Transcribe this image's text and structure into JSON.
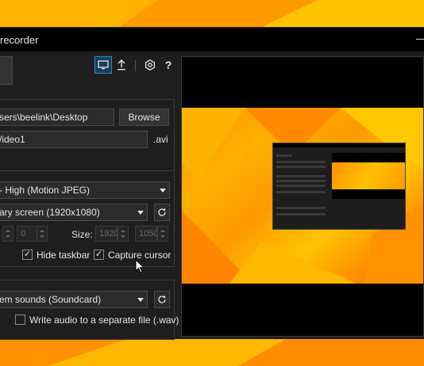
{
  "window": {
    "title": "recorder"
  },
  "toolbar": {
    "icons": [
      "monitor-icon",
      "upload-icon",
      "gear-icon",
      "question-icon"
    ]
  },
  "output": {
    "folder_value": "sers\\beelink\\Desktop",
    "browse_label": "Browse",
    "filename_value": "/ideo1",
    "extension": ".avi"
  },
  "video": {
    "codec_selected": "- High (Motion JPEG)",
    "source_selected": "ary screen (1920x1080)",
    "position_y": "0",
    "size_label": "Size:",
    "width_value": "1920",
    "height_value": "1050",
    "hide_taskbar_label": "Hide taskbar",
    "hide_taskbar_checked": true,
    "capture_cursor_label": "Capture cursor",
    "capture_cursor_checked": true
  },
  "audio": {
    "source_selected": "em sounds (Soundcard)",
    "separate_file_label": "Write audio to a separate file (.wav)",
    "separate_file_checked": false
  },
  "colors": {
    "accent": "#1e8fd6",
    "window_bg": "#1e1e1e",
    "wallpaper": "#ffa800"
  }
}
